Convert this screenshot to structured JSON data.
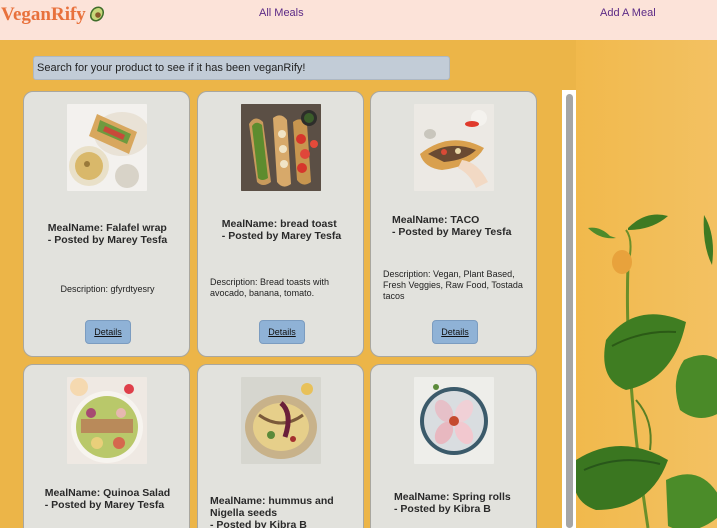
{
  "nav": {
    "brand": "VeganRify",
    "brand_icon": "avocado-icon",
    "links": [
      {
        "label": "All Meals"
      },
      {
        "label": "Add A Meal"
      }
    ]
  },
  "search": {
    "placeholder": "Search for your product to see if it has been veganRify!"
  },
  "details_label": "Details",
  "meals": [
    {
      "title_line1": "MealName: Falafel wrap",
      "title_line2": "- Posted by Marey Tesfa",
      "description": "Description: gfyrdtyesry"
    },
    {
      "title_line1": "MealName: bread toast",
      "title_line2": "- Posted by Marey Tesfa",
      "description": "Description: Bread toasts with avocado, banana, tomato."
    },
    {
      "title_line1": "MealName: TACO",
      "title_line2": "- Posted by Marey Tesfa",
      "description": "Description: Vegan, Plant Based, Fresh Veggies, Raw Food, Tostada tacos"
    },
    {
      "title_line1": "MealName: Quinoa Salad",
      "title_line2": "- Posted by Marey Tesfa"
    },
    {
      "title_line1": "MealName: hummus and",
      "title_line2": "Nigella seeds",
      "title_line3": "- Posted by Kibra B"
    },
    {
      "title_line1": "MealName: Spring rolls",
      "title_line2": "- Posted by Kibra B"
    }
  ],
  "colors": {
    "navbar_bg": "#fce3d9",
    "page_bg": "#ecb548",
    "brand": "#e8713c",
    "nav_link": "#5b2a86",
    "card_bg": "#e2e2dd",
    "button_bg": "#8fb2d6",
    "search_bg": "#c2ccd7"
  }
}
